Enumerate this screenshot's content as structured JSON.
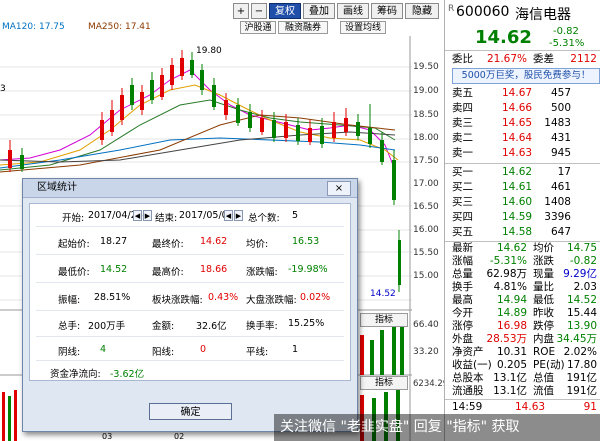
{
  "toolbar": {
    "plus": "+",
    "minus": "−",
    "weight_right": "复权",
    "overlay": "叠加",
    "draw_line": "画线",
    "chip": "筹码",
    "hide": "隐藏"
  },
  "ma_labels": {
    "ma120": "MA120: 17.75",
    "ma250": "MA250: 17.41"
  },
  "sub_buttons": {
    "sh": "沪股通",
    "margin": "融资融券",
    "ma_set": "设置均线"
  },
  "peak_label": "19.80",
  "low_label": "14.52",
  "y_ticks": [
    "19.50",
    "19.00",
    "18.50",
    "18.00",
    "17.50",
    "17.00",
    "16.50",
    "16.00",
    "15.50",
    "15.00"
  ],
  "lower_ticks": [
    "66.40",
    "33.20"
  ],
  "vol_tick": "6234.29",
  "indicator_buttons": [
    "指标",
    "指标"
  ],
  "x_labels": [
    "03",
    "02"
  ],
  "left_tick": "3",
  "stock": {
    "code": "600060",
    "name": "海信电器",
    "price": "14.62",
    "change": "-0.82",
    "pct": "-5.31%"
  },
  "ratio_row": {
    "wb_label": "委比",
    "wb": "21.67%",
    "wc_label": "委差",
    "wc": "2112"
  },
  "ad": "5000万巨奖，股民免费参与！",
  "sells": [
    {
      "label": "卖五",
      "price": "14.67",
      "vol": "457"
    },
    {
      "label": "卖四",
      "price": "14.66",
      "vol": "500"
    },
    {
      "label": "卖三",
      "price": "14.65",
      "vol": "1483"
    },
    {
      "label": "卖二",
      "price": "14.64",
      "vol": "431"
    },
    {
      "label": "卖一",
      "price": "14.63",
      "vol": "945"
    }
  ],
  "buys": [
    {
      "label": "买一",
      "price": "14.62",
      "vol": "17"
    },
    {
      "label": "买二",
      "price": "14.61",
      "vol": "461"
    },
    {
      "label": "买三",
      "price": "14.60",
      "vol": "1408"
    },
    {
      "label": "买四",
      "price": "14.59",
      "vol": "3396"
    },
    {
      "label": "买五",
      "price": "14.58",
      "vol": "647"
    }
  ],
  "stats": [
    {
      "l1": "最新",
      "v1": "14.62",
      "l2": "均价",
      "v2": "14.75"
    },
    {
      "l1": "涨幅",
      "v1": "-5.31%",
      "l2": "涨跌",
      "v2": "-0.82"
    },
    {
      "l1": "总量",
      "v1": "62.98万",
      "l2": "现量",
      "v2": "9.29亿"
    },
    {
      "l1": "换手",
      "v1": "4.81%",
      "l2": "量比",
      "v2": "2.03"
    },
    {
      "l1": "最高",
      "v1": "14.94",
      "l2": "最低",
      "v2": "14.52"
    },
    {
      "l1": "今开",
      "v1": "14.89",
      "l2": "昨收",
      "v2": "15.44"
    },
    {
      "l1": "涨停",
      "v1": "16.98",
      "l2": "跌停",
      "v2": "13.90"
    },
    {
      "l1": "外盘",
      "v1": "28.53万",
      "l2": "内盘",
      "v2": "34.45万"
    },
    {
      "l1": "净资产",
      "v1": "10.31",
      "l2": "ROE",
      "v2": "2.02%"
    },
    {
      "l1": "收益(一)",
      "v1": "0.205",
      "l2": "PE(动)",
      "v2": "17.80"
    },
    {
      "l1": "总股本",
      "v1": "13.1亿",
      "l2": "总值",
      "v2": "191亿"
    },
    {
      "l1": "流通股",
      "v1": "13.1亿",
      "l2": "流值",
      "v2": "191亿"
    }
  ],
  "tick": {
    "time": "14:59",
    "price": "14.63",
    "vol": "91"
  },
  "dialog": {
    "title": "区域统计",
    "close": "×",
    "start_label": "开始:",
    "start_date": "2017/04/26",
    "end_label": "结束:",
    "end_date": "2017/05/03",
    "count_label": "总个数:",
    "count": "5",
    "open_label": "起始价:",
    "open": "18.27",
    "close_label": "最终价:",
    "close_price": "14.62",
    "avg_label": "均价:",
    "avg": "16.53",
    "low_label": "最低价:",
    "low": "14.52",
    "high_label": "最高价:",
    "high": "18.66",
    "chg_label": "涨跌幅:",
    "chg": "-19.98%",
    "amp_label": "振幅:",
    "amp": "28.51%",
    "sector_label": "板块涨跌幅:",
    "sector": "0.43%",
    "market_label": "大盘涨跌幅:",
    "market": "0.02%",
    "vol_label": "总手:",
    "vol": "200万手",
    "amt_label": "金额:",
    "amt": "32.6亿",
    "turn_label": "换手率:",
    "turn": "15.25%",
    "yin_label": "阴线:",
    "yin": "4",
    "yang_label": "阳线:",
    "yang": "0",
    "flat_label": "平线:",
    "flat": "1",
    "flow_label": "资金净流向:",
    "flow": "-3.62亿",
    "ok": "确定"
  },
  "watermark": "关注微信 \"老韭实盘\" 回复 \"指标\" 获取",
  "colors": {
    "up": "#e00000",
    "down": "#008000",
    "accent": "#1f4fa8"
  }
}
